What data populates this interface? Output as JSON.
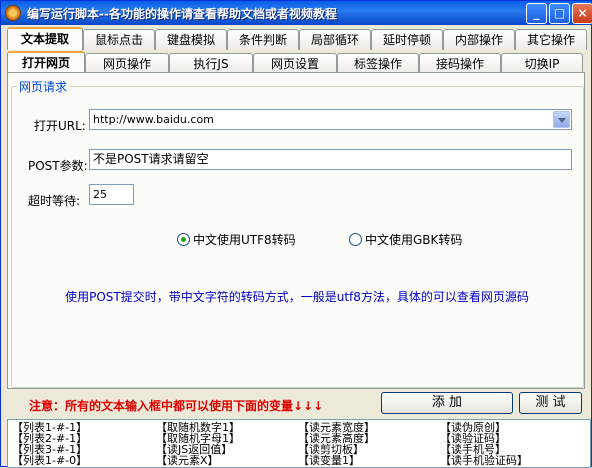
{
  "window": {
    "title": "编写运行脚本--各功能的操作请查看帮助文档或者视频教程",
    "minimize": "_",
    "maximize": "□",
    "close": "×"
  },
  "main_tabs": [
    {
      "label": "文本提取",
      "active": true
    },
    {
      "label": "鼠标点击"
    },
    {
      "label": "键盘模拟"
    },
    {
      "label": "条件判断"
    },
    {
      "label": "局部循环"
    },
    {
      "label": "延时停顿"
    },
    {
      "label": "内部操作"
    },
    {
      "label": "其它操作"
    }
  ],
  "sub_tabs": [
    {
      "label": "打开网页",
      "active": true
    },
    {
      "label": "网页操作"
    },
    {
      "label": "执行JS"
    },
    {
      "label": "网页设置"
    },
    {
      "label": "标签操作"
    },
    {
      "label": "接码操作"
    },
    {
      "label": "切换IP"
    }
  ],
  "group": {
    "title": "网页请求"
  },
  "form": {
    "url_label": "打开URL:",
    "url_value": "http://www.baidu.com",
    "post_label": "POST参数:",
    "post_value": "不是POST请求请留空",
    "timeout_label": "超时等待:",
    "timeout_value": "25",
    "radio_utf8": "中文使用UTF8转码",
    "radio_gbk": "中文使用GBK转码",
    "selected_encoding": "utf8"
  },
  "hint": "使用POST提交时，带中文字符的转码方式，一般是utf8方法，具体的可以查看网页源码",
  "notice": "注意：所有的文本输入框中都可以使用下面的变量↓↓↓",
  "buttons": {
    "add": "添  加",
    "test": "测 试"
  },
  "variables": {
    "col1": [
      "【列表1-#-1】",
      "【列表2-#-1】",
      "【列表3-#-1】",
      "【列表1-#-0】"
    ],
    "col2": [
      "【取随机数字1】",
      "【取随机字母1】",
      "【读JS返回值】",
      "【读元素X】"
    ],
    "col3": [
      "【读元素宽度】",
      "【读元素高度】",
      "【读剪切板】",
      "【读变量1】"
    ],
    "col4": [
      "【读伪原创】",
      "【读验证码】",
      "【读手机号】",
      "【读手机验证码】"
    ]
  }
}
